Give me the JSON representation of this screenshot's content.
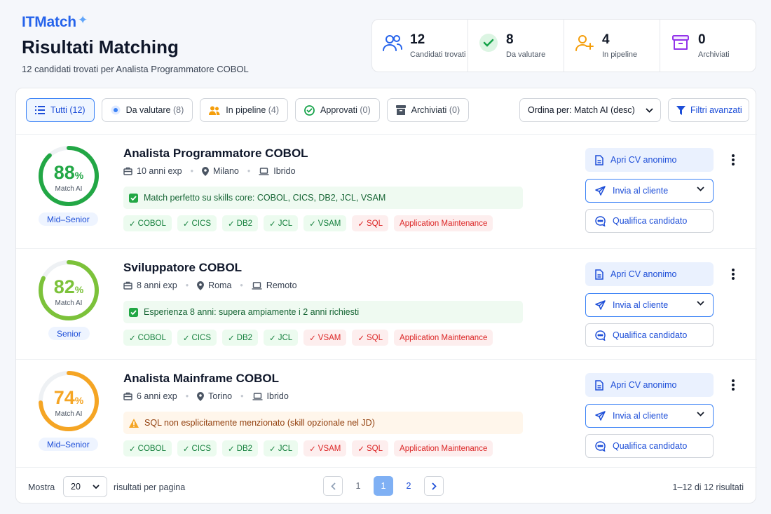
{
  "brand": {
    "name": "ITMatch",
    "spark": "✦"
  },
  "header": {
    "title": "Risultati Matching",
    "subtitle": "12 candidati trovati per Analista Programmatore COBOL"
  },
  "stats": [
    {
      "value": "12",
      "label": "Candidati trovati",
      "icon": "users-icon",
      "color": "#2563eb"
    },
    {
      "value": "8",
      "label": "Da valutare",
      "icon": "check-circle-icon",
      "color": "#16a34a"
    },
    {
      "value": "4",
      "label": "In pipeline",
      "icon": "user-plus-icon",
      "color": "#f59e0b"
    },
    {
      "value": "0",
      "label": "Archiviati",
      "icon": "archive-icon",
      "color": "#9333ea"
    }
  ],
  "filters": [
    {
      "label": "Tutti",
      "count": "(12)",
      "active": true
    },
    {
      "label": "Da valutare",
      "count": "(8)"
    },
    {
      "label": "In pipeline",
      "count": "(4)"
    },
    {
      "label": "Approvati",
      "count": "(0)"
    },
    {
      "label": "Archiviati",
      "count": "(0)"
    }
  ],
  "sort": {
    "label": "Ordina per: Match AI (desc)"
  },
  "advanced_filters": {
    "label": "Filtri avanzati"
  },
  "actions": {
    "cv": "Apri CV anonimo",
    "send": "Invia al cliente",
    "qualify": "Qualifica candidato"
  },
  "candidates": [
    {
      "score": "88",
      "pct": "%",
      "score_label": "Match AI",
      "score_value": 0.88,
      "score_color": "#22a745",
      "level": "Mid–Senior",
      "title": "Analista Programmatore COBOL",
      "experience": "10 anni exp",
      "city": "Milano",
      "mode": "Ibrido",
      "note": "Match perfetto su skills core: COBOL, CICS, DB2, JCL, VSAM",
      "note_type": "ok",
      "tags": [
        {
          "label": "COBOL",
          "type": "g"
        },
        {
          "label": "CICS",
          "type": "g"
        },
        {
          "label": "DB2",
          "type": "g"
        },
        {
          "label": "JCL",
          "type": "g"
        },
        {
          "label": "VSAM",
          "type": "g"
        },
        {
          "label": "SQL",
          "type": "r"
        },
        {
          "label": "Application Maintenance",
          "type": "r",
          "nocheck": true
        }
      ]
    },
    {
      "score": "82",
      "pct": "%",
      "score_label": "Match AI",
      "score_value": 0.82,
      "score_color": "#7cc23a",
      "level": "Senior",
      "title": "Sviluppatore COBOL",
      "experience": "8 anni exp",
      "city": "Roma",
      "mode": "Remoto",
      "note": "Esperienza 8 anni: supera ampiamente i 2 anni richiesti",
      "note_type": "ok",
      "tags": [
        {
          "label": "COBOL",
          "type": "g"
        },
        {
          "label": "CICS",
          "type": "g"
        },
        {
          "label": "DB2",
          "type": "g"
        },
        {
          "label": "JCL",
          "type": "g"
        },
        {
          "label": "VSAM",
          "type": "r"
        },
        {
          "label": "SQL",
          "type": "r"
        },
        {
          "label": "Application Maintenance",
          "type": "r",
          "nocheck": true
        }
      ]
    },
    {
      "score": "74",
      "pct": "%",
      "score_label": "Match AI",
      "score_value": 0.74,
      "score_color": "#f5a524",
      "level": "Mid–Senior",
      "title": "Analista Mainframe COBOL",
      "experience": "6 anni exp",
      "city": "Torino",
      "mode": "Ibrido",
      "note": "SQL non esplicitamente menzionato (skill opzionale nel JD)",
      "note_type": "warn",
      "tags": [
        {
          "label": "COBOL",
          "type": "g"
        },
        {
          "label": "CICS",
          "type": "g"
        },
        {
          "label": "DB2",
          "type": "g"
        },
        {
          "label": "JCL",
          "type": "g"
        },
        {
          "label": "VSAM",
          "type": "r"
        },
        {
          "label": "SQL",
          "type": "r"
        },
        {
          "label": "Application Maintenance",
          "type": "r",
          "nocheck": true
        }
      ]
    }
  ],
  "footer": {
    "show_label": "Mostra",
    "page_size": "20",
    "per_page_label": "risultati per pagina",
    "pages": [
      "1",
      "1",
      "2"
    ],
    "range": "1–12 di 12 risultati"
  }
}
